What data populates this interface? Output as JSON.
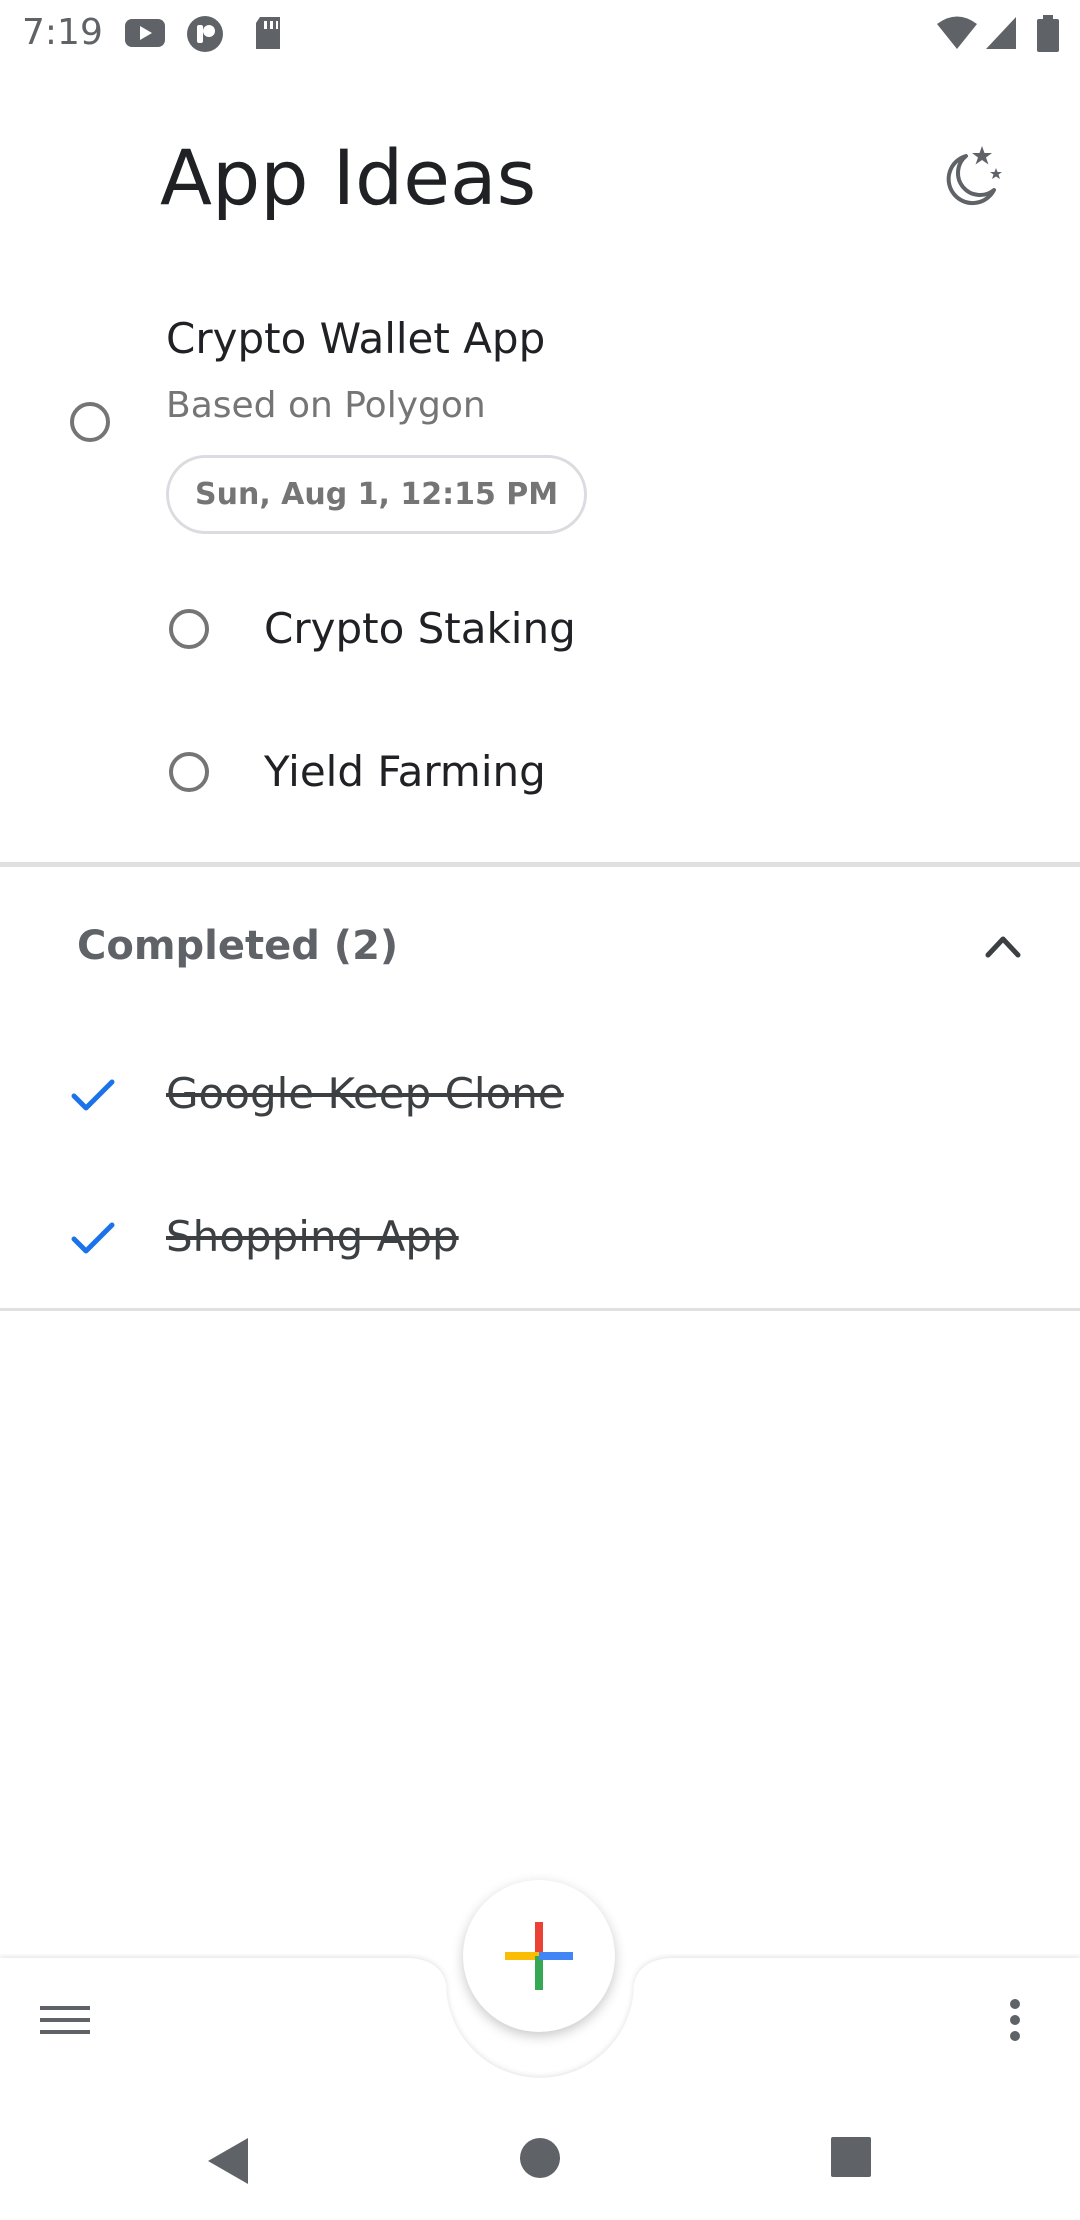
{
  "status_bar": {
    "time": "7:19",
    "left_icons": [
      "youtube-icon",
      "app-notification-icon",
      "sd-card-icon"
    ],
    "right_icons": [
      "wifi-icon",
      "signal-icon",
      "battery-icon"
    ]
  },
  "header": {
    "title": "App Ideas",
    "theme_icon": "dark-mode-moon-icon"
  },
  "tasks": [
    {
      "title": "Crypto Wallet App",
      "details": "Based on Polygon",
      "date_chip": "Sun, Aug 1, 12:15 PM",
      "subtasks": [
        {
          "title": "Crypto Staking"
        },
        {
          "title": "Yield Farming"
        }
      ]
    }
  ],
  "completed": {
    "header": "Completed (2)",
    "toggle_icon": "chevron-up-icon",
    "items": [
      {
        "title": "Google Keep Clone"
      },
      {
        "title": "Shopping App"
      }
    ]
  },
  "bottom_bar": {
    "menu_icon": "hamburger-menu-icon",
    "fab_icon": "add-plus-icon",
    "more_icon": "more-vert-icon"
  },
  "colors": {
    "accent_check": "#1a73e8",
    "fab_red": "#ea4335",
    "fab_yellow": "#fbbc04",
    "fab_green": "#34a853",
    "fab_blue": "#4285f4"
  },
  "nav": [
    "back-icon",
    "home-icon",
    "recents-icon"
  ]
}
